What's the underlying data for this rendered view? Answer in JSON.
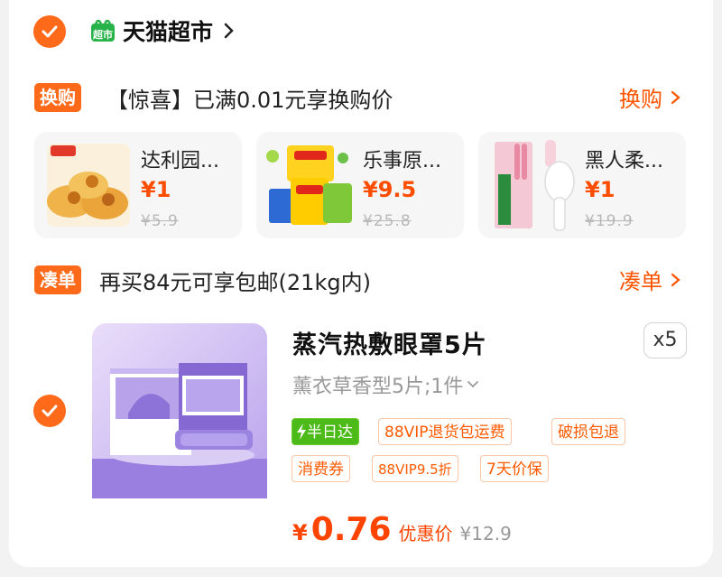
{
  "store": {
    "icon_text": "超市",
    "name": "天猫超市"
  },
  "swap": {
    "tag": "换购",
    "text": "【惊喜】已满0.01元享换购价",
    "link": "换购"
  },
  "gifts": [
    {
      "name": "达利园...",
      "price": "¥1",
      "original": "¥5.9"
    },
    {
      "name": "乐事原...",
      "price": "¥9.5",
      "original": "¥25.8"
    },
    {
      "name": "黑人柔...",
      "price": "¥1",
      "original": "¥19.9"
    }
  ],
  "bundle": {
    "tag": "凑单",
    "text": "再买84元可享包邮(21kg内)",
    "link": "凑单"
  },
  "product": {
    "title": "蒸汽热敷眼罩5片",
    "quantity": "x5",
    "variant": "薰衣草香型5片;1件",
    "tags": [
      "半日达",
      "88VIP退货包运费",
      "破损包退",
      "消费券",
      "88VIP9.5折",
      "7天价保"
    ],
    "price_symbol": "¥",
    "price": "0.76",
    "price_label": "优惠价",
    "original_price": "¥12.9"
  },
  "colors": {
    "accent": "#ff6a1a",
    "price": "#ff4400",
    "green": "#4cba18"
  }
}
